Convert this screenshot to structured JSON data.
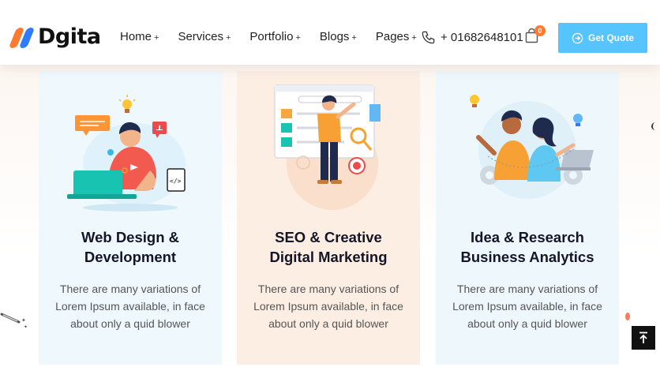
{
  "brand": {
    "name": "Dgita",
    "logo_colors": [
      "#ff7a2f",
      "#2f7bff"
    ]
  },
  "nav": [
    {
      "label": "Home",
      "suffix": "+"
    },
    {
      "label": "Services",
      "suffix": "+"
    },
    {
      "label": "Portfolio",
      "suffix": "+"
    },
    {
      "label": "Blogs",
      "suffix": "+"
    },
    {
      "label": "Pages",
      "suffix": "+"
    }
  ],
  "phone": {
    "icon": "phone-icon",
    "number": "+ 01682648101"
  },
  "cart": {
    "icon": "shopping-bag-icon",
    "count": "0"
  },
  "quote_button": {
    "label": "Get Quote",
    "icon": "arrow-circle-icon",
    "color": "#55c4ff"
  },
  "cards": [
    {
      "title_line1": "Web Design &",
      "title_line2": "Development",
      "text_line1": "There are many variations of",
      "text_line2": "Lorem Ipsum available, in face",
      "text_line3": "about only a quid blower",
      "background": "#eef8fd"
    },
    {
      "title_line1": "SEO & Creative",
      "title_line2": "Digital Marketing",
      "text_line1": "There are many variations of",
      "text_line2": "Lorem Ipsum available, in face",
      "text_line3": "about only a quid blower",
      "background": "#fdeee3"
    },
    {
      "title_line1": "Idea & Research",
      "title_line2": "Business Analytics",
      "text_line1": "There are many variations of",
      "text_line2": "Lorem Ipsum available, in face",
      "text_line3": "about only a quid blower",
      "background": "#eef7fc"
    }
  ],
  "scroll_top": {
    "icon": "arrow-up-icon"
  }
}
